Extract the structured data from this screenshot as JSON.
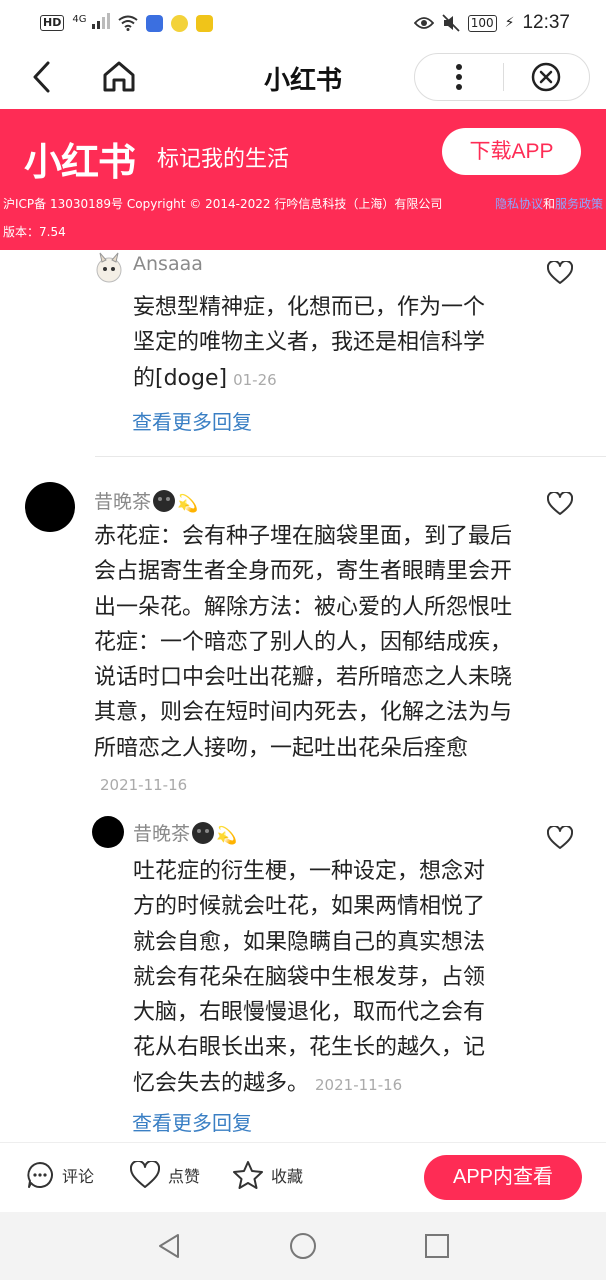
{
  "status_bar": {
    "hd": "HD",
    "network": "4G",
    "battery": "100",
    "time": "12:37"
  },
  "nav": {
    "title": "小红书",
    "icons": [
      "back-icon",
      "home-icon",
      "more-icon",
      "close-icon"
    ]
  },
  "banner": {
    "logo": "小红书",
    "slogan": "标记我的生活",
    "download_label": "下载APP",
    "icp": "沪ICP备 13030189号 Copyright © 2014-2022 行吟信息科技（上海）有限公司",
    "privacy_link": "隐私协议",
    "and": "和",
    "service_link": "服务政策",
    "version": "版本：7.54",
    "colors": {
      "brand": "#fe2c55",
      "link": "#8ea6ff"
    }
  },
  "comments": {
    "reply_top": {
      "username": "Ansaaa",
      "text": "妄想型精神症，化想而已，作为一个坚定的唯物主义者，我还是相信科学的[doge]",
      "time": "01-26",
      "more_replies": "查看更多回复"
    },
    "main": {
      "username": "昔晚茶",
      "text": "赤花症：会有种子埋在脑袋里面，到了最后会占据寄生者全身而死，寄生者眼睛里会开出一朵花。解除方法：被心爱的人所怨恨吐花症：一个暗恋了别人的人，因郁结成疾，说话时口中会吐出花瓣，若所暗恋之人未晓其意，则会在短时间内死去，化解之法为与所暗恋之人接吻，一起吐出花朵后痊愈",
      "time": "2021-11-16"
    },
    "reply": {
      "username": "昔晚茶",
      "text": "吐花症的衍生梗，一种设定，想念对方的时候就会吐花，如果两情相悦了就会自愈，如果隐瞒自己的真实想法就会有花朵在脑袋中生根发芽，占领大脑，右眼慢慢退化，取而代之会有花从右眼长出来，花生长的越久，记忆会失去的越多。",
      "time": "2021-11-16",
      "more_replies": "查看更多回复"
    },
    "colors": {
      "username": "#8a8a8a",
      "link": "#3a7fc4",
      "time": "#aaaaaa"
    }
  },
  "action_bar": {
    "comment_label": "评论",
    "like_label": "点赞",
    "collect_label": "收藏",
    "app_view_label": "APP内查看"
  },
  "system_nav": {
    "icons": [
      "back-triangle-icon",
      "home-circle-icon",
      "recents-square-icon"
    ]
  }
}
